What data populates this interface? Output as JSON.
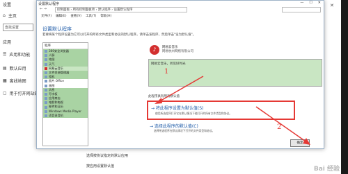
{
  "settings": {
    "title": "设置",
    "home": "主页",
    "search_placeholder": "查找设置",
    "section": "应用",
    "items": [
      "应用和功能",
      "默认应用",
      "离线地图",
      "用于打开网站的应用"
    ],
    "bottom_links": [
      "选择按协议指定的默认应用",
      "按应用设置默认值"
    ]
  },
  "control_panel": {
    "title": "设置默认程序",
    "address": "控制面板 › 所有控制面板项 › 默认程序 › 设置默认程序",
    "menu": [
      "文件(F)",
      "编辑(E)",
      "查看(V)",
      "工具(T)",
      "帮助(H)"
    ],
    "heading": "设置默认程序",
    "description": "若要将某个程序设置为它可以打开的所有文件类型和协议的默认程序，请单击该程序，然后单击\"设为默认值\"。",
    "list_header": "程序",
    "programs": [
      "360安全浏览器",
      "人脉",
      "地图",
      "天气",
      "网易云音乐",
      "文件资源管理器",
      "相机",
      "照片 Office",
      "画图",
      "消息",
      "写字板",
      "应用商店",
      "电影和电视",
      "邮件和日历",
      "Windows Media Player",
      "语音录音机"
    ],
    "app_name": "网易云音乐",
    "app_publisher": "网易杭州网络有限公司",
    "app_desc": "网易云音乐，听见好时光",
    "section_label": "此程序具有所有默认值",
    "option1_title": "→ 将此程序设置为默认值(S)",
    "option1_desc": "使用所选程序打开它在默认情况下能打开的所有文件类型和协议。",
    "option2_title": "→ 选择此程序的默认值(C)",
    "option2_desc": "选择所选程序在默认情况下打开的文件类型和协议。",
    "ok_label": "确定"
  },
  "annotations": [
    "1",
    "2"
  ],
  "watermark": "Bai 经验"
}
